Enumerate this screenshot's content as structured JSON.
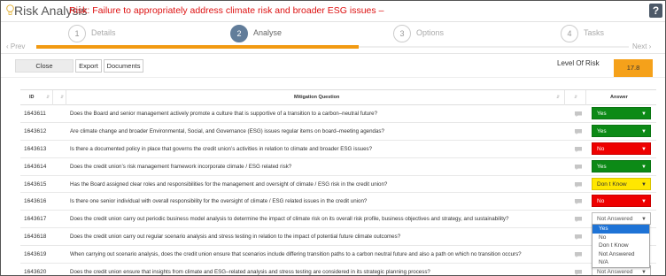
{
  "header": {
    "app_title": "Risk Analysis",
    "risk_text": "Risk: Failure to appropriately address climate risk and broader ESG issues –",
    "help_label": "?"
  },
  "wizard": {
    "steps": [
      {
        "num": "1",
        "label": "Details"
      },
      {
        "num": "2",
        "label": "Analyse"
      },
      {
        "num": "3",
        "label": "Options"
      },
      {
        "num": "4",
        "label": "Tasks"
      }
    ],
    "prev_label": "‹ Prev",
    "next_label": "Next ›",
    "progress": 0.5
  },
  "toolbar": {
    "close_label": "Close",
    "export_label": "Export",
    "documents_label": "Documents",
    "risk_level_label": "Level Of Risk",
    "risk_level_value": "17.8",
    "risk_level_color": "#f5a11a"
  },
  "table": {
    "headers": {
      "id": "ID",
      "question": "Mitigation Question",
      "answer": "Answer"
    },
    "rows": [
      {
        "id": "1643611",
        "question": "Does the Board and senior management actively promote a culture that is supportive of a transition to a carbon–neutral future?",
        "answer": "Yes",
        "state": "Yes"
      },
      {
        "id": "1643612",
        "question": "Are climate change and broader Environmental, Social, and Governance (ESG) issues regular items on board–meeting agendas?",
        "answer": "Yes",
        "state": "Yes"
      },
      {
        "id": "1643613",
        "question": "Is there a documented policy in place that governs the credit union’s activities in relation to climate and broader ESG issues?",
        "answer": "No",
        "state": "No"
      },
      {
        "id": "1643614",
        "question": "Does the credit union’s risk management framework incorporate climate / ESG related risk?",
        "answer": "Yes",
        "state": "Yes"
      },
      {
        "id": "1643615",
        "question": "Has the Board assigned clear roles and responsibilities for the management and oversight of climate / ESG risk in the credit union?",
        "answer": "Don t Know",
        "state": "DontKnow"
      },
      {
        "id": "1643616",
        "question": "Is there one senior individual with overall responsibility for the oversight of climate / ESG related issues in the credit union?",
        "answer": "No",
        "state": "No"
      },
      {
        "id": "1643617",
        "question": "Does the credit union carry out periodic business model analysis to determine the impact of climate risk on its overall risk profile, business objectives and strategy, and sustainability?",
        "answer": "Not Answered",
        "state": "NotAnswered"
      },
      {
        "id": "1643618",
        "question": "Does the credit union carry out regular scenario analysis and stress testing in relation to the impact of potential future climate outcomes?",
        "answer": "",
        "state": "hidden"
      },
      {
        "id": "1643619",
        "question": "When carrying out scenario analysis, does the credit union ensure that scenarios include differing transition paths to a carbon neutral future and also a path on which no transition occurs?",
        "answer": "",
        "state": "hidden"
      },
      {
        "id": "1643620",
        "question": "Does the credit union ensure that insights from climate and ESG–related analysis and stress testing are considered in its strategic planning process?",
        "answer": "Not Answered",
        "state": "NotAnswered"
      }
    ]
  },
  "dropdown": {
    "options": [
      "Yes",
      "No",
      "Don t Know",
      "Not Answered",
      "N/A"
    ],
    "highlighted": "Yes"
  },
  "icons": {
    "comment": "comment-icon",
    "lightbulb": "lightbulb-icon",
    "caret": "chevron-down-icon"
  }
}
